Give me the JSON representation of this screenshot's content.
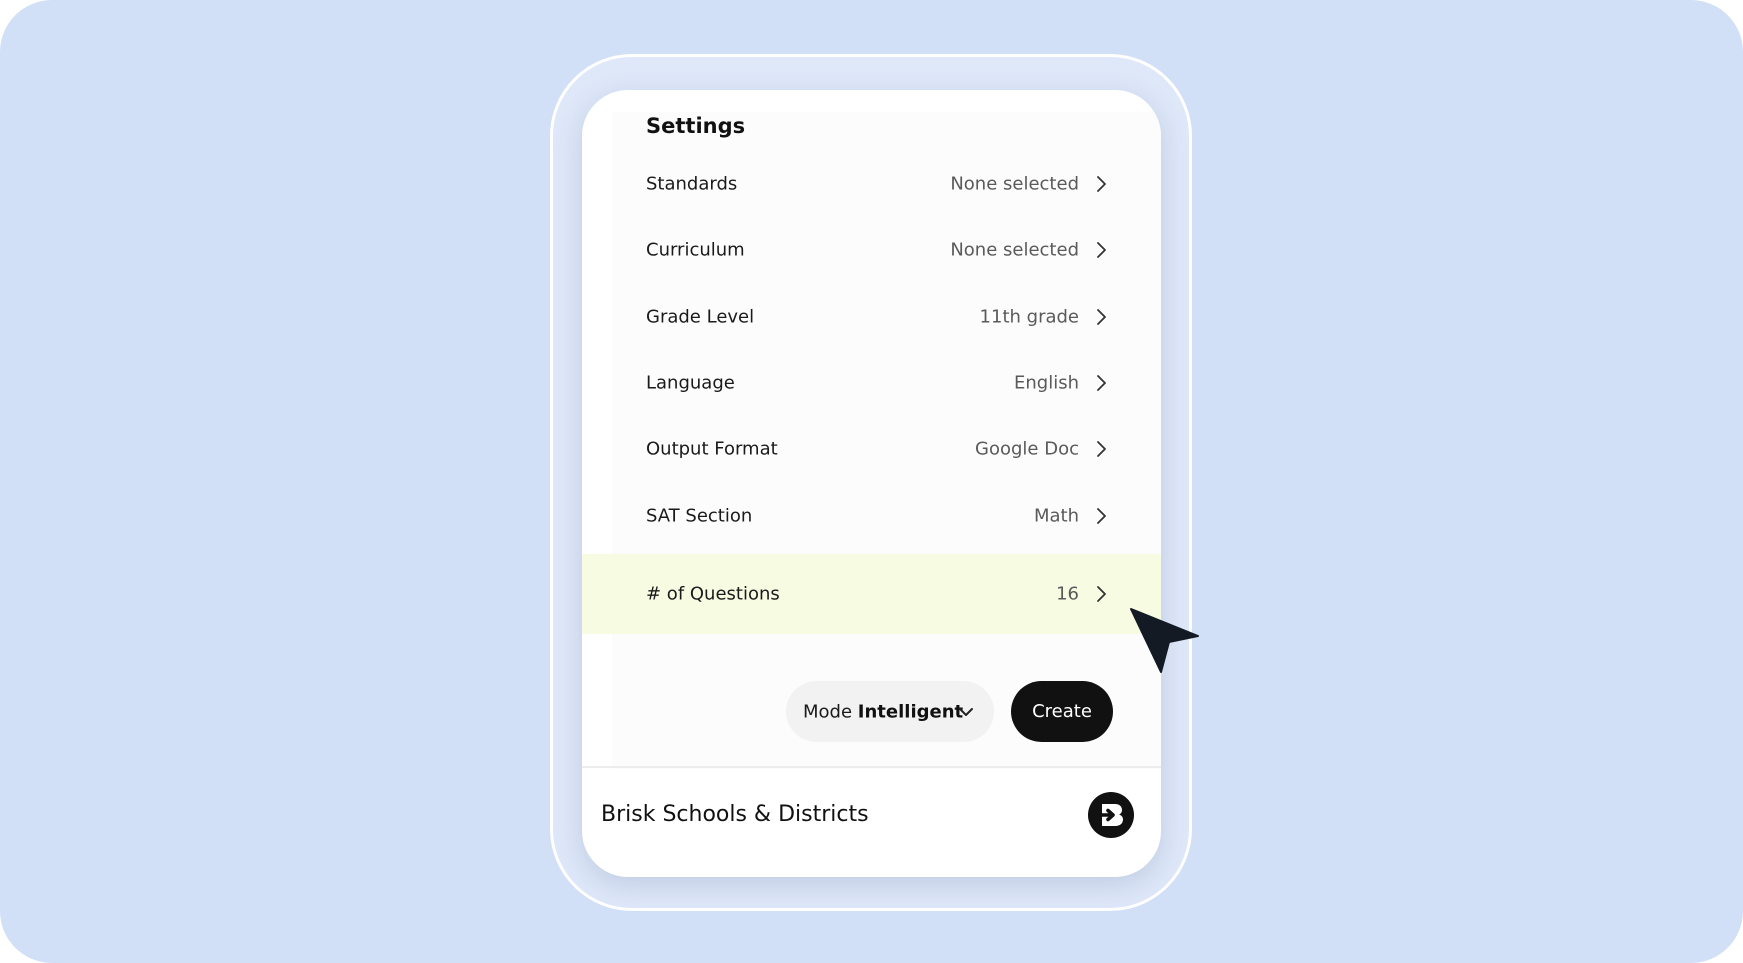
{
  "settings": {
    "title": "Settings",
    "rows": [
      {
        "label": "Standards",
        "value": "None selected"
      },
      {
        "label": "Curriculum",
        "value": "None selected"
      },
      {
        "label": "Grade Level",
        "value": "11th grade"
      },
      {
        "label": "Language",
        "value": "English"
      },
      {
        "label": "Output Format",
        "value": "Google Doc"
      },
      {
        "label": "SAT Section",
        "value": "Math"
      },
      {
        "label": "# of Questions",
        "value": "16"
      }
    ]
  },
  "actions": {
    "mode_label": "Mode",
    "mode_value": "Intelligent",
    "create_label": "Create"
  },
  "footer": {
    "brand_text": "Brisk Schools & Districts"
  },
  "colors": {
    "background": "#d1dff7",
    "highlight_row": "#f7fbe2",
    "primary_button": "#111111"
  },
  "icons": [
    "chevron-right-icon",
    "chevron-down-icon",
    "brisk-logo-icon",
    "mouse-pointer-icon"
  ]
}
